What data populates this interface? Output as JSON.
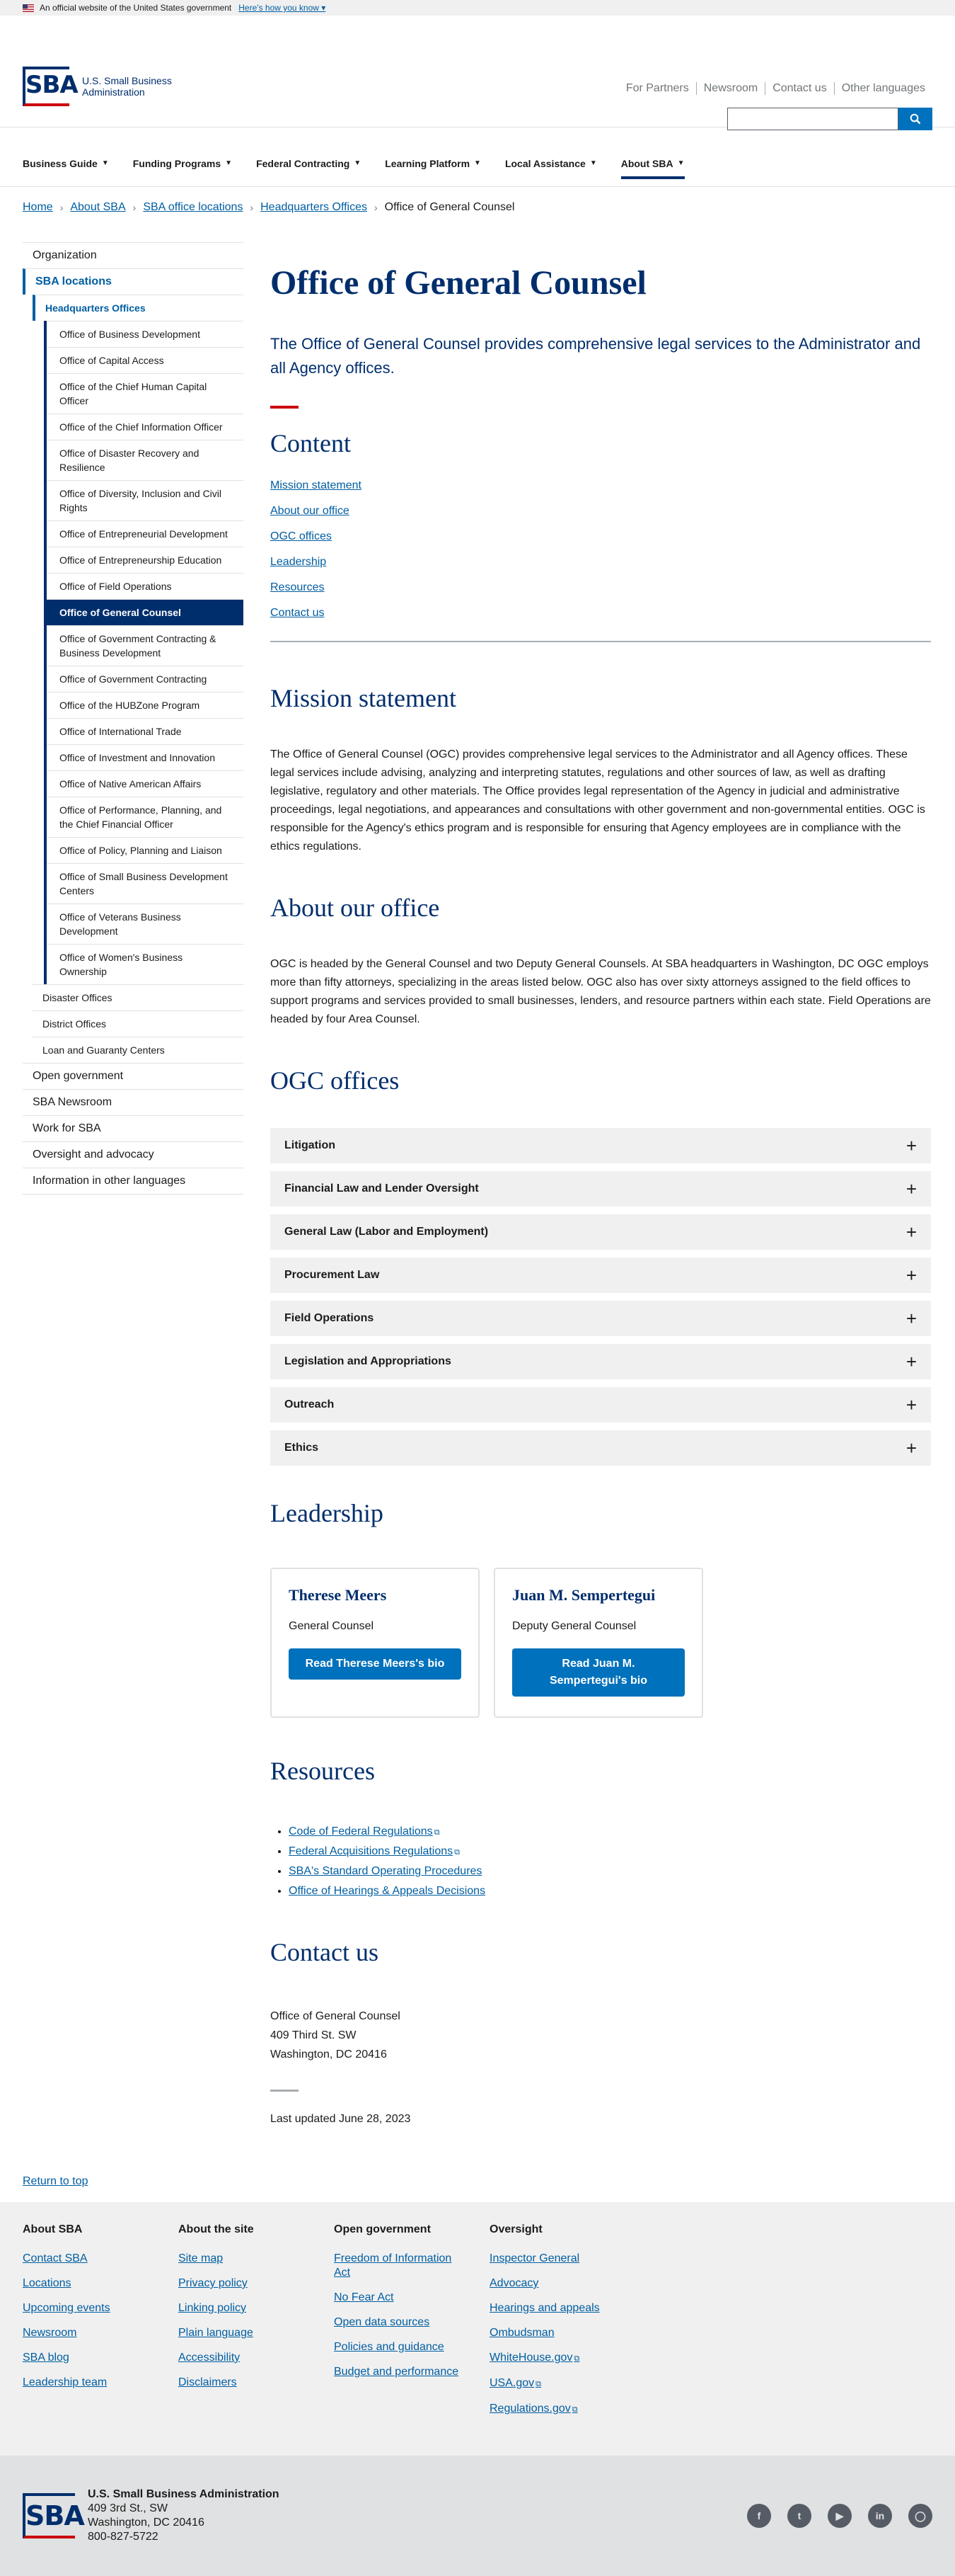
{
  "gov_banner": {
    "text": "An official website of the United States government",
    "link": "Here's how you know"
  },
  "header": {
    "logo_letters": "SBA",
    "logo_line1": "U.S. Small Business",
    "logo_line2": "Administration",
    "utility_links": [
      "For Partners",
      "Newsroom",
      "Contact us",
      "Other languages"
    ],
    "search_placeholder": ""
  },
  "nav": {
    "items": [
      "Business Guide",
      "Funding Programs",
      "Federal Contracting",
      "Learning Platform",
      "Local Assistance",
      "About SBA"
    ],
    "active_index": 5
  },
  "breadcrumb": [
    "Home",
    "About SBA",
    "SBA office locations",
    "Headquarters Offices",
    "Office of General Counsel"
  ],
  "sidenav": {
    "top": [
      "Organization",
      "SBA locations"
    ],
    "level2_title": "Headquarters Offices",
    "hq_offices": [
      "Office of Business Development",
      "Office of Capital Access",
      "Office of the Chief Human Capital Officer",
      "Office of the Chief Information Officer",
      "Office of Disaster Recovery and Resilience",
      "Office of Diversity, Inclusion and Civil Rights",
      "Office of Entrepreneurial Development",
      "Office of Entrepreneurship Education",
      "Office of Field Operations",
      "Office of General Counsel",
      "Office of Government Contracting & Business Development",
      "Office of Government Contracting",
      "Office of the HUBZone Program",
      "Office of International Trade",
      "Office of Investment and Innovation",
      "Office of Native American Affairs",
      "Office of Performance, Planning, and the Chief Financial Officer",
      "Office of Policy, Planning and Liaison",
      "Office of Small Business Development Centers",
      "Office of Veterans Business Development",
      "Office of Women's Business Ownership"
    ],
    "current_index": 9,
    "level2_more": [
      "Disaster Offices",
      "District Offices",
      "Loan and Guaranty Centers"
    ],
    "bottom": [
      "Open government",
      "SBA Newsroom",
      "Work for SBA",
      "Oversight and advocacy",
      "Information in other languages"
    ]
  },
  "main": {
    "title": "Office of General Counsel",
    "lede": "The Office of General Counsel provides comprehensive legal services to the Administrator and all Agency offices.",
    "content_heading": "Content",
    "toc": [
      "Mission statement",
      "About our office",
      "OGC offices",
      "Leadership",
      "Resources",
      "Contact us"
    ],
    "mission_heading": "Mission statement",
    "mission_text": "The Office of General Counsel (OGC) provides comprehensive legal services to the Administrator and all Agency offices. These legal services include advising, analyzing and interpreting statutes, regulations and other sources of law, as well as drafting legislative, regulatory and other materials.  The Office provides legal representation of the Agency in judicial and administrative proceedings, legal negotiations, and appearances and consultations with other government and non-governmental entities.  OGC is responsible for the Agency's ethics program and is responsible for ensuring that Agency employees are in compliance with the ethics regulations.",
    "about_heading": "About our office",
    "about_text": "OGC is headed by the General Counsel and two Deputy General Counsels. At SBA headquarters in Washington, DC OGC employs more than fifty attorneys, specializing in the areas listed below. OGC also has over sixty attorneys assigned to the field offices to support programs and services provided to small businesses, lenders, and resource partners within each state.  Field Operations are headed by four Area Counsel.",
    "offices_heading": "OGC offices",
    "offices": [
      "Litigation",
      "Financial Law and Lender Oversight",
      "General Law (Labor and Employment)",
      "Procurement Law",
      "Field Operations",
      "Legislation and Appropriations",
      "Outreach",
      "Ethics"
    ],
    "leadership_heading": "Leadership",
    "leaders": [
      {
        "name": "Therese Meers",
        "title": "General Counsel",
        "button": "Read Therese Meers's bio"
      },
      {
        "name": "Juan M. Sempertegui",
        "title": "Deputy General Counsel",
        "button": "Read Juan M. Sempertegui's bio"
      }
    ],
    "resources_heading": "Resources",
    "resources": [
      {
        "label": "Code of Federal Regulations",
        "external": true
      },
      {
        "label": "Federal Acquisitions Regulations",
        "external": true
      },
      {
        "label": "SBA's Standard Operating Procedures",
        "external": false
      },
      {
        "label": "Office of Hearings & Appeals Decisions",
        "external": false
      }
    ],
    "contact_heading": "Contact us",
    "contact_address": [
      "Office of General Counsel",
      "409 Third St. SW",
      "Washington, DC 20416"
    ],
    "last_updated": "Last updated June 28, 2023"
  },
  "return_to_top": "Return to top",
  "footer": {
    "columns": [
      {
        "heading": "About SBA",
        "links": [
          "Contact SBA",
          "Locations",
          "Upcoming events",
          "Newsroom",
          "SBA blog",
          "Leadership team"
        ]
      },
      {
        "heading": "About the site",
        "links": [
          "Site map",
          "Privacy policy",
          "Linking policy",
          "Plain language",
          "Accessibility",
          "Disclaimers"
        ]
      },
      {
        "heading": "Open government",
        "links": [
          "Freedom of Information Act",
          "No Fear Act",
          "Open data sources",
          "Policies and guidance",
          "Budget and performance"
        ]
      },
      {
        "heading": "Oversight",
        "links": [
          "Inspector General",
          "Advocacy",
          "Hearings and appeals",
          "Ombudsman",
          "WhiteHouse.gov",
          "USA.gov",
          "Regulations.gov"
        ]
      }
    ],
    "external_links": [
      "WhiteHouse.gov",
      "USA.gov",
      "Regulations.gov"
    ]
  },
  "bottom": {
    "agency_name": "U.S. Small Business Administration",
    "address1": "409 3rd St., SW",
    "address2": "Washington, DC 20416",
    "phone": "800-827-5722",
    "socials": [
      "facebook-icon",
      "twitter-icon",
      "youtube-icon",
      "linkedin-icon",
      "instagram-icon"
    ]
  },
  "colors": {
    "primary_navy": "#002e6d",
    "link_blue": "#005ea2",
    "button_blue": "#0071bc",
    "accent_red": "#cc0000"
  }
}
